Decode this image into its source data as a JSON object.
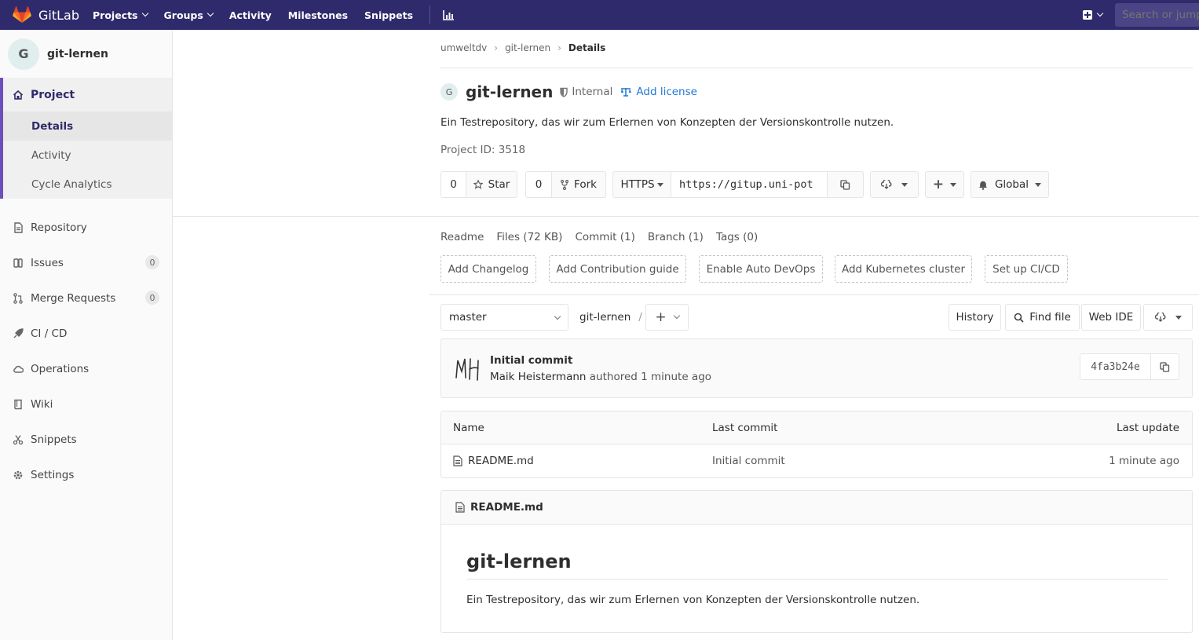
{
  "navbar": {
    "brand": "GitLab",
    "items": [
      {
        "label": "Projects",
        "dropdown": true
      },
      {
        "label": "Groups",
        "dropdown": true
      },
      {
        "label": "Activity",
        "dropdown": false
      },
      {
        "label": "Milestones",
        "dropdown": false
      },
      {
        "label": "Snippets",
        "dropdown": false
      }
    ],
    "search_placeholder": "Search or jump to…",
    "colors": {
      "bg": "#2f2a6b",
      "accent": "#6b4fbb",
      "link": "#1f78d1"
    }
  },
  "sidebar": {
    "avatar_letter": "G",
    "project_name": "git-lernen",
    "project_label": "Project",
    "sub_items": [
      "Details",
      "Activity",
      "Cycle Analytics"
    ],
    "items": [
      {
        "label": "Repository",
        "icon": "doc-icon"
      },
      {
        "label": "Issues",
        "icon": "issues-icon",
        "badge": "0"
      },
      {
        "label": "Merge Requests",
        "icon": "merge-icon",
        "badge": "0"
      },
      {
        "label": "CI / CD",
        "icon": "rocket-icon"
      },
      {
        "label": "Operations",
        "icon": "cloud-icon"
      },
      {
        "label": "Wiki",
        "icon": "book-icon"
      },
      {
        "label": "Snippets",
        "icon": "scissors-icon"
      },
      {
        "label": "Settings",
        "icon": "gear-icon"
      }
    ]
  },
  "breadcrumb": {
    "group": "umweltdv",
    "project": "git-lernen",
    "current": "Details"
  },
  "project": {
    "avatar_letter": "G",
    "name": "git-lernen",
    "visibility": "Internal",
    "add_license": "Add license",
    "description": "Ein Testrepository, das wir zum Erlernen von Konzepten der Versionskontrolle nutzen.",
    "project_id": "Project ID: 3518"
  },
  "actions": {
    "star_count": "0",
    "star_label": "Star",
    "fork_count": "0",
    "fork_label": "Fork",
    "protocol": "HTTPS",
    "clone_url": "https://gitup.uni-pot",
    "notification": "Global"
  },
  "stats": [
    "Readme",
    "Files (72 KB)",
    "Commit (1)",
    "Branch (1)",
    "Tags (0)"
  ],
  "suggestions": [
    "Add Changelog",
    "Add Contribution guide",
    "Enable Auto DevOps",
    "Add Kubernetes cluster",
    "Set up CI/CD"
  ],
  "tree": {
    "branch": "master",
    "path_root": "git-lernen",
    "path_sep": "/",
    "history": "History",
    "find_file": "Find file",
    "web_ide": "Web IDE"
  },
  "commit": {
    "title": "Initial commit",
    "author": "Maik Heistermann",
    "meta_suffix": "authored 1 minute ago",
    "sha": "4fa3b24e"
  },
  "files": {
    "headers": {
      "name": "Name",
      "last_commit": "Last commit",
      "last_update": "Last update"
    },
    "rows": [
      {
        "name": "README.md",
        "last_commit": "Initial commit",
        "last_update": "1 minute ago"
      }
    ]
  },
  "readme": {
    "filename": "README.md",
    "heading": "git-lernen",
    "text": "Ein Testrepository, das wir zum Erlernen von Konzepten der Versionskontrolle nutzen."
  }
}
